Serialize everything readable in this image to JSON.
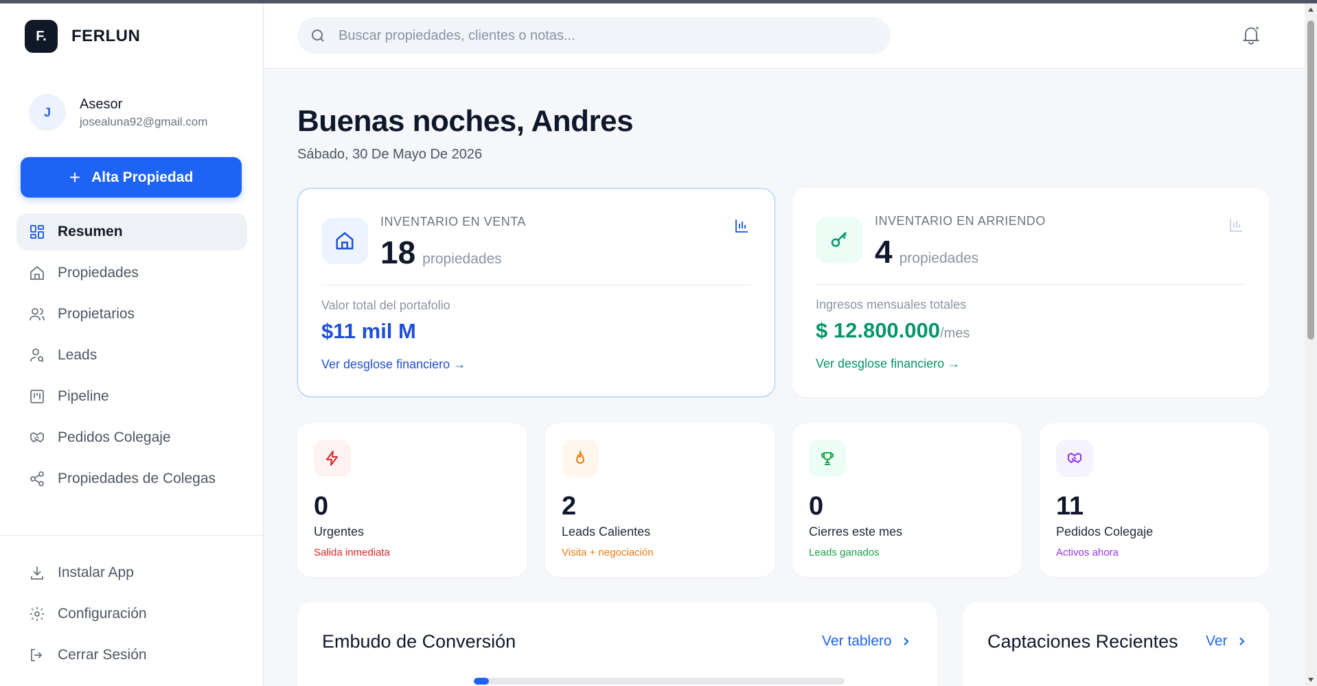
{
  "brand": {
    "logo_letter": "F.",
    "name": "FERLUN"
  },
  "user": {
    "initial": "J",
    "role": "Asesor",
    "email": "josealuna92@gmail.com"
  },
  "primary_action": {
    "label": "Alta Propiedad"
  },
  "nav": [
    {
      "label": "Resumen",
      "icon": "grid-icon",
      "active": true
    },
    {
      "label": "Propiedades",
      "icon": "home-icon"
    },
    {
      "label": "Propietarios",
      "icon": "users-icon"
    },
    {
      "label": "Leads",
      "icon": "user-search-icon"
    },
    {
      "label": "Pipeline",
      "icon": "kanban-icon"
    },
    {
      "label": "Pedidos Colegaje",
      "icon": "handshake-icon"
    },
    {
      "label": "Propiedades de Colegas",
      "icon": "share-icon"
    }
  ],
  "nav_bottom": [
    {
      "label": "Instalar App",
      "icon": "download-icon"
    },
    {
      "label": "Configuración",
      "icon": "gear-icon"
    },
    {
      "label": "Cerrar Sesión",
      "icon": "logout-icon"
    }
  ],
  "search": {
    "placeholder": "Buscar propiedades, clientes o notas..."
  },
  "header": {
    "greeting": "Buenas noches, Andres",
    "date": "Sábado, 30 De Mayo De 2026"
  },
  "inventory": [
    {
      "label": "INVENTARIO EN VENTA",
      "count": "18",
      "unit": "propiedades",
      "sub_label": "Valor total del portafolio",
      "value": "$11 mil M",
      "value_suffix": "",
      "link": "Ver desglose financiero →",
      "color": "#1d4ed8",
      "icon": "home-icon"
    },
    {
      "label": "INVENTARIO EN ARRIENDO",
      "count": "4",
      "unit": "propiedades",
      "sub_label": "Ingresos mensuales totales",
      "value": "$ 12.800.000",
      "value_suffix": "/mes",
      "link": "Ver desglose financiero →",
      "color": "#059669",
      "icon": "key-icon"
    }
  ],
  "stats": [
    {
      "value": "0",
      "label": "Urgentes",
      "sub": "Salida inmediata",
      "color": "#dc2626",
      "icon": "lightning-icon"
    },
    {
      "value": "2",
      "label": "Leads Calientes",
      "sub": "Visita + negociación",
      "color": "#ea7a0c",
      "icon": "flame-icon"
    },
    {
      "value": "0",
      "label": "Cierres este mes",
      "sub": "Leads ganados",
      "color": "#16a34a",
      "icon": "trophy-icon"
    },
    {
      "value": "11",
      "label": "Pedidos Colegaje",
      "sub": "Activos ahora",
      "color": "#9333ea",
      "icon": "handshake-icon"
    }
  ],
  "sections": {
    "funnel": {
      "title": "Embudo de Conversión",
      "link": "Ver tablero"
    },
    "recent": {
      "title": "Captaciones Recientes",
      "link": "Ver"
    }
  },
  "funnel_progress": 0.04
}
